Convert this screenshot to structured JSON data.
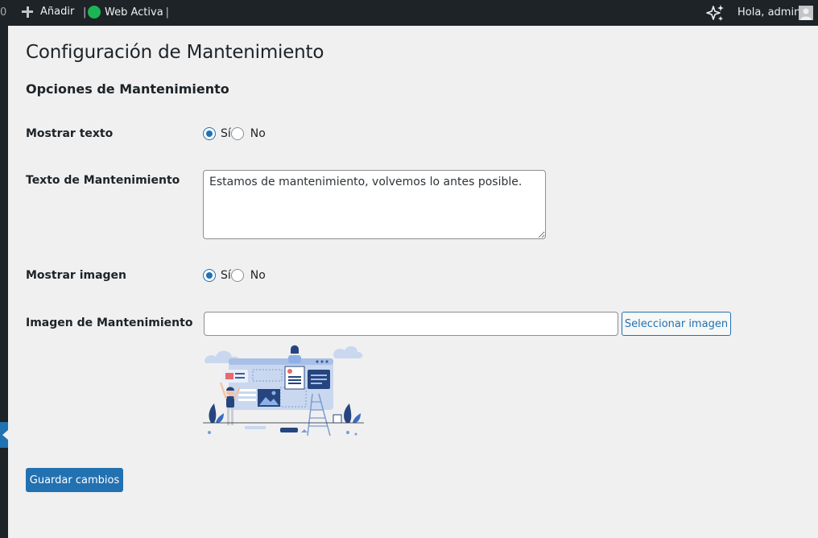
{
  "adminbar": {
    "counter": "0",
    "add_label": "Añadir",
    "separator": "|",
    "status_label": "Web Activa",
    "greeting": "Hola, admin",
    "status_color": "#1cb454"
  },
  "page": {
    "title": "Configuración de Mantenimiento",
    "section_title": "Opciones de Mantenimiento"
  },
  "form": {
    "show_text": {
      "label": "Mostrar texto",
      "options": [
        "Sí",
        "No"
      ],
      "selected": "Sí"
    },
    "maintenance_text": {
      "label": "Texto de Mantenimiento",
      "value": "Estamos de mantenimiento, volvemos lo antes posible."
    },
    "show_image": {
      "label": "Mostrar imagen",
      "options": [
        "Sí",
        "No"
      ],
      "selected": "Sí"
    },
    "maintenance_image": {
      "label": "Imagen de Mantenimiento",
      "value": "",
      "select_button": "Seleccionar imagen"
    },
    "save_button": "Guardar cambios"
  },
  "colors": {
    "accent": "#2271b1",
    "admin_bar": "#1d2327",
    "background": "#f0f0f1"
  }
}
